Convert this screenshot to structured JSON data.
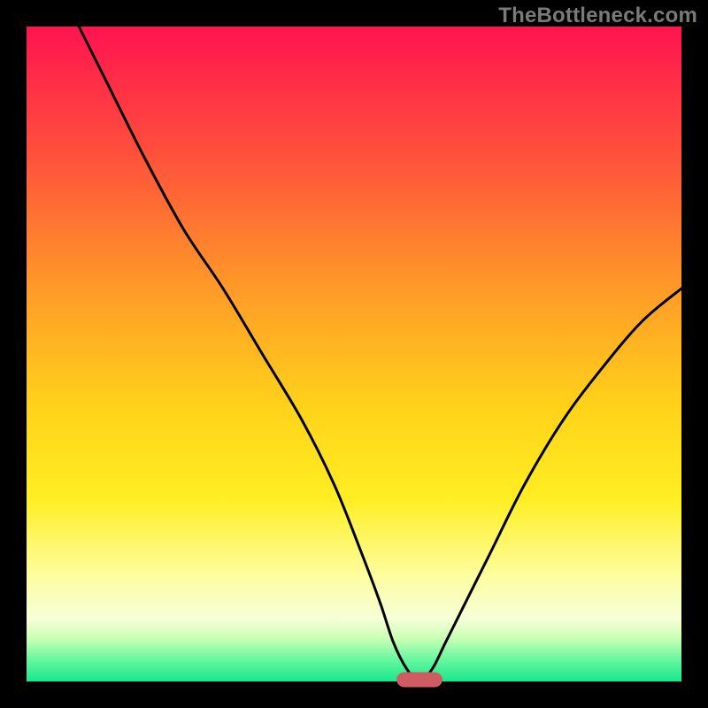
{
  "watermark": "TheBottleneck.com",
  "colors": {
    "frame": "#000000",
    "curve": "#000000",
    "marker_fill": "#cf5b63",
    "gradient_stops": [
      {
        "offset": 0.0,
        "color": "#ff1450"
      },
      {
        "offset": 0.18,
        "color": "#ff4b3d"
      },
      {
        "offset": 0.4,
        "color": "#ff9a28"
      },
      {
        "offset": 0.58,
        "color": "#ffd21a"
      },
      {
        "offset": 0.72,
        "color": "#ffee22"
      },
      {
        "offset": 0.84,
        "color": "#fdfea0"
      },
      {
        "offset": 0.905,
        "color": "#f6ffd8"
      },
      {
        "offset": 0.935,
        "color": "#c8ffb4"
      },
      {
        "offset": 0.965,
        "color": "#6cf7a0"
      },
      {
        "offset": 1.0,
        "color": "#18e88c"
      }
    ]
  },
  "layout": {
    "outer_size": 800,
    "inner_x": 30,
    "inner_y": 30,
    "inner_w": 740,
    "inner_h": 740
  },
  "chart_data": {
    "type": "line",
    "title": "",
    "xlabel": "",
    "ylabel": "",
    "xlim": [
      0,
      100
    ],
    "ylim": [
      0,
      100
    ],
    "x": [
      8,
      12,
      18,
      24,
      30,
      36,
      42,
      47,
      51,
      54,
      56,
      58,
      60,
      62,
      64,
      67,
      71,
      76,
      82,
      88,
      94,
      100
    ],
    "values": [
      100,
      92,
      80,
      69,
      60,
      50,
      40,
      30,
      20,
      12,
      6,
      2,
      0,
      2,
      6,
      12,
      20,
      30,
      40,
      48,
      55,
      60
    ],
    "marker": {
      "x_center": 60,
      "y": 0,
      "width": 7,
      "height": 2.3
    },
    "grid": false,
    "legend": false
  }
}
